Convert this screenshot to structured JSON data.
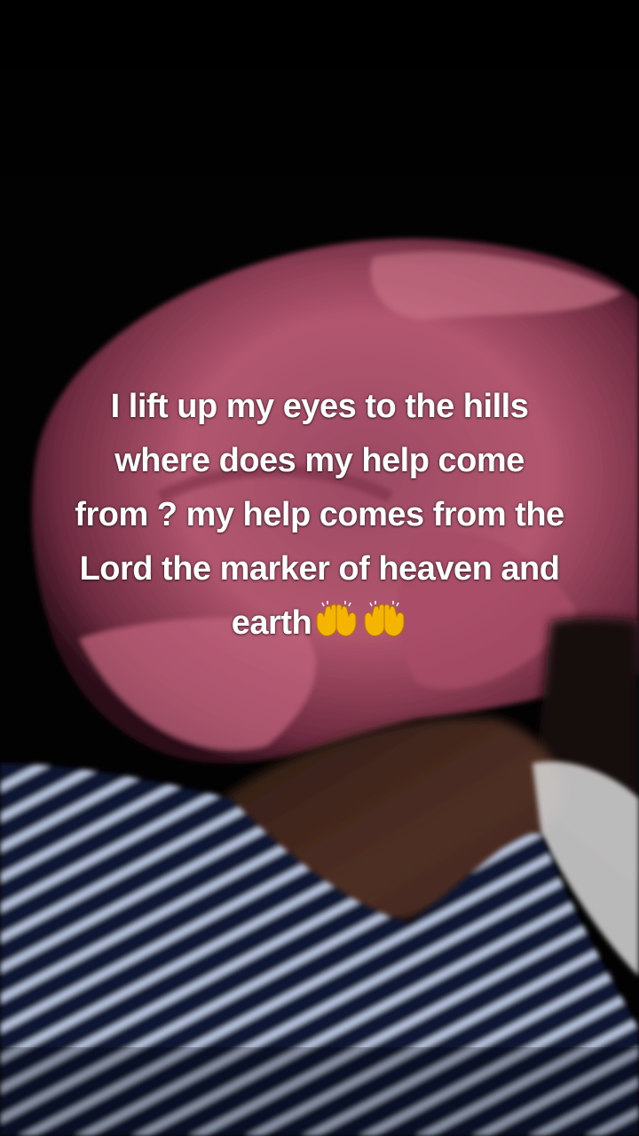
{
  "caption": {
    "line1": "I lift up my eyes to the hills",
    "line2": "where does my help come",
    "line3": "from ? my help comes from the",
    "line4": "Lord the marker of heaven and",
    "line5": "earth"
  },
  "emojis": [
    "raising-hands-icon",
    "raising-hands-icon"
  ],
  "colors": {
    "background": "#020202",
    "cap": "#b2566f",
    "shirt_dark": "#0d1330",
    "shirt_stripe": "#b9c6e0",
    "skin": "#4a2c22",
    "caption_text": "#ffffff"
  }
}
